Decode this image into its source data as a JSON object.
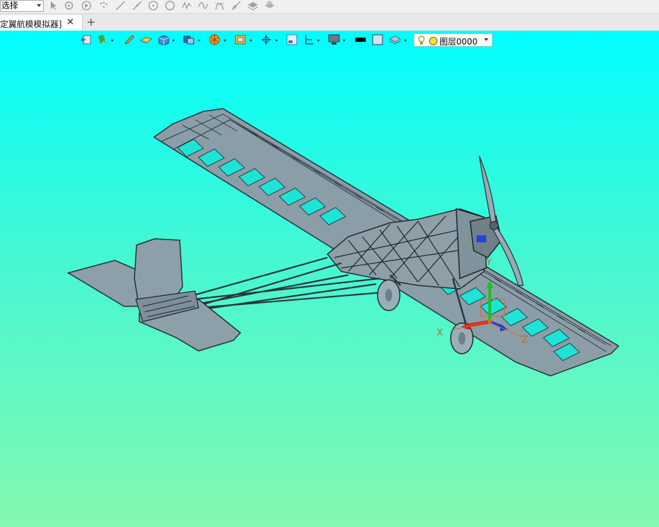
{
  "command_bar": {
    "filter_value": "选择",
    "icons": [
      "pointer-icon",
      "snap-icon",
      "play-icon",
      "points-icon",
      "line-icon",
      "segment-icon",
      "circle-center-icon",
      "circle-icon",
      "curve-icon",
      "spline-icon",
      "arc-icon",
      "tangent-line-icon",
      "layer-stack-icon",
      "layer-group-icon"
    ]
  },
  "tabs": {
    "active_title": "定翼航模模拟器]",
    "close_glyph": "✕",
    "add_glyph": "+"
  },
  "view_toolbar": {
    "layer_name": "图层0000",
    "colors": {
      "fill_color": "#000000",
      "background_swatch": "#cfe6f0"
    }
  },
  "viewport": {
    "gradient": [
      "#00fefe",
      "#84f8b0"
    ],
    "axes": {
      "x_label": "X",
      "y_label": "Y",
      "z_label": "Z",
      "x_color": "#e02020",
      "y_color": "#20c020",
      "z_color": "#1c3ad0"
    }
  }
}
